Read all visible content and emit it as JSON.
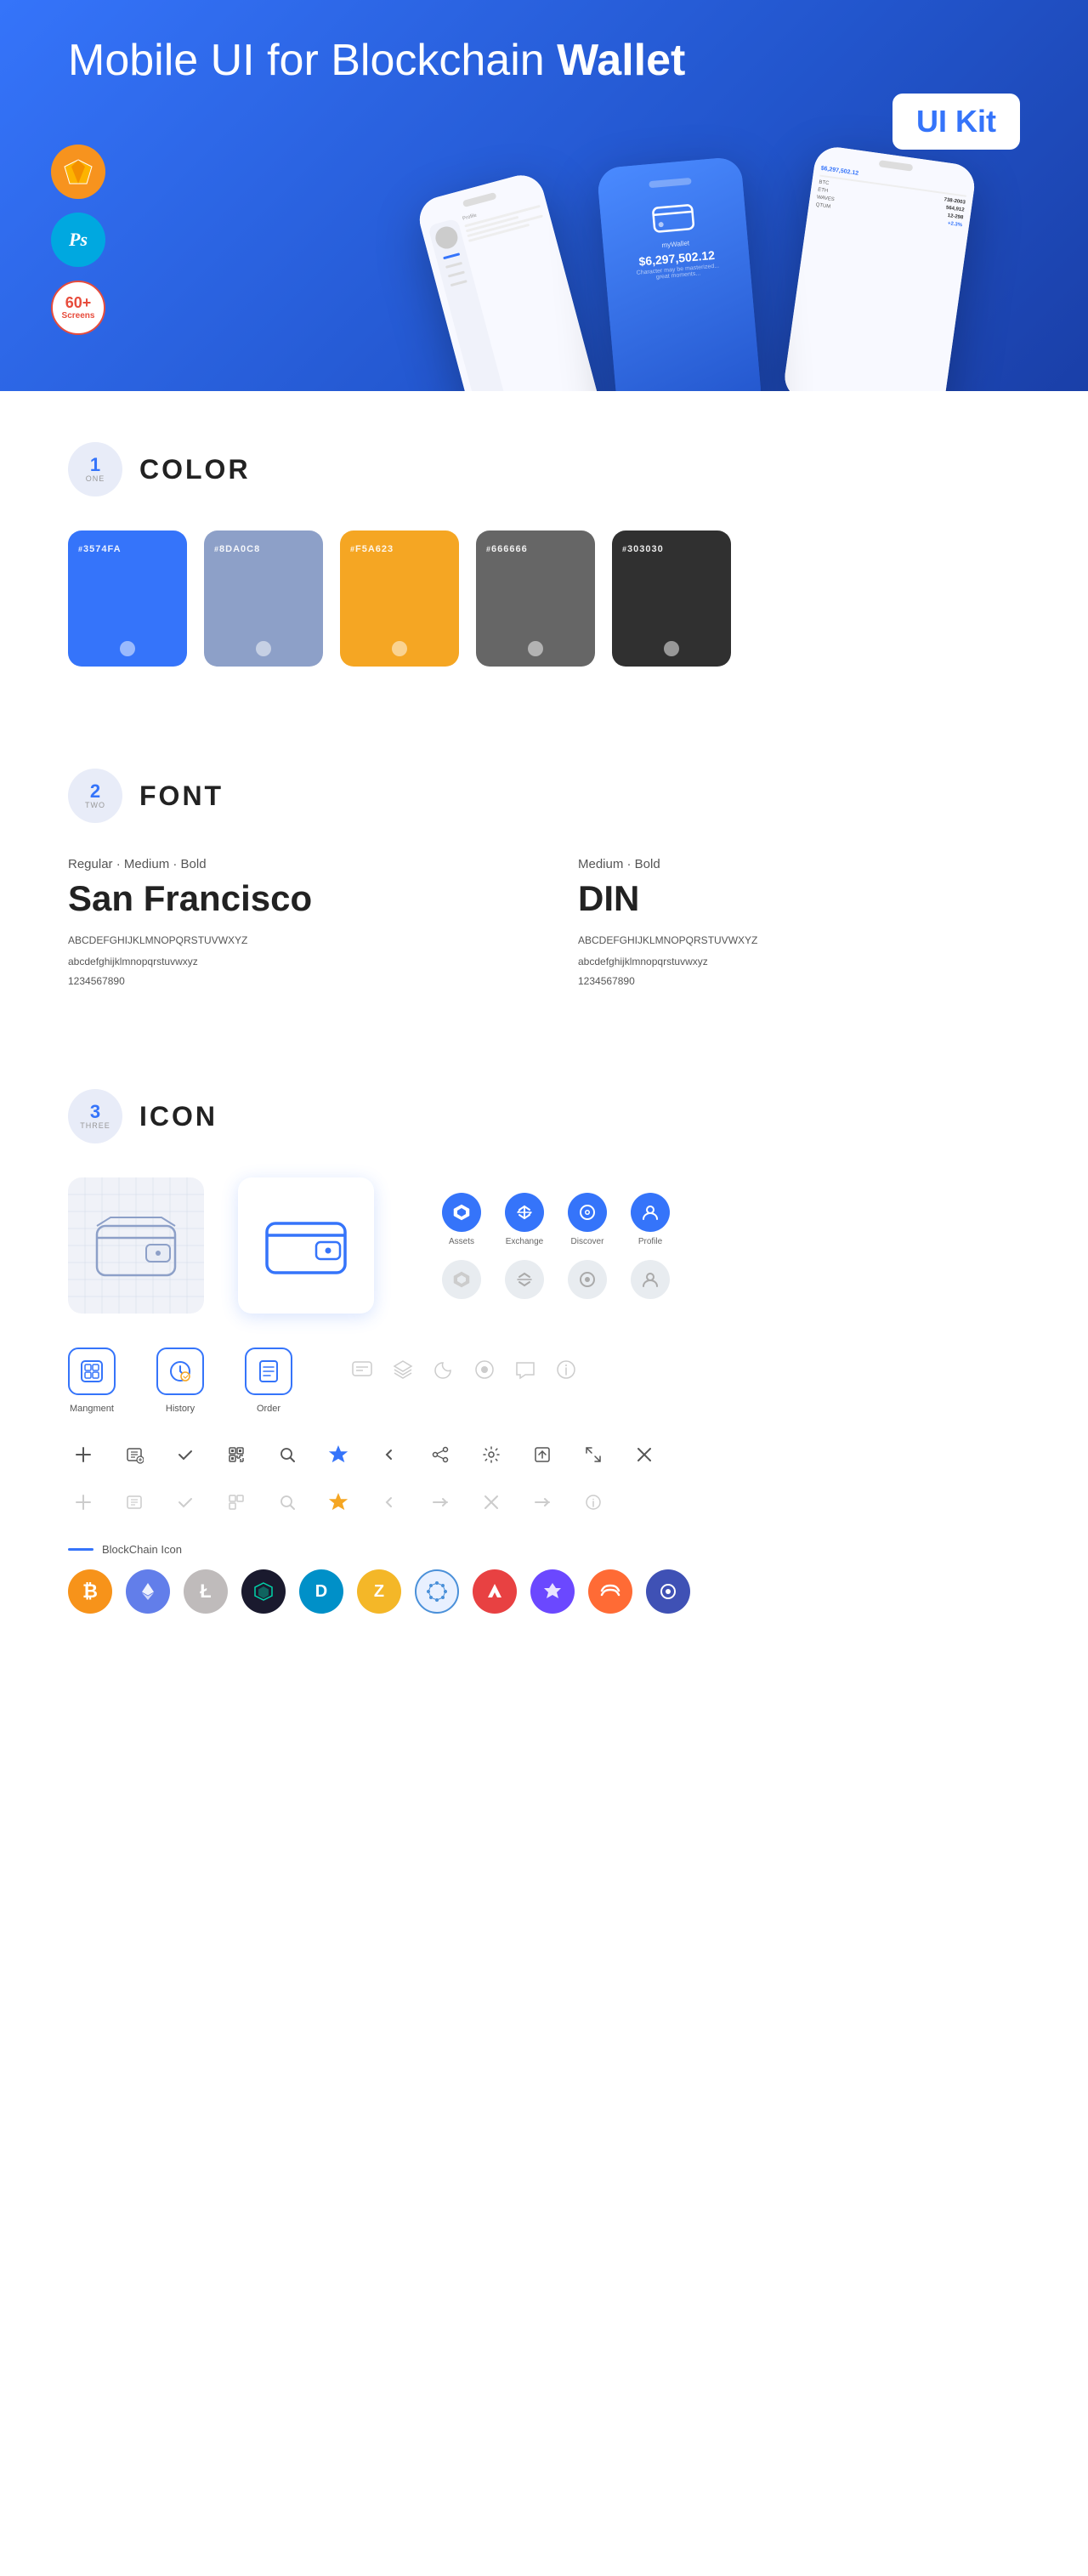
{
  "hero": {
    "title_normal": "Mobile UI for Blockchain ",
    "title_bold": "Wallet",
    "badge": "UI Kit",
    "badges": [
      {
        "label": "Sketch",
        "type": "sketch"
      },
      {
        "label": "Ps",
        "type": "ps"
      },
      {
        "label": "60+\nScreens",
        "type": "screens"
      }
    ]
  },
  "sections": {
    "color": {
      "number": "1",
      "word": "ONE",
      "title": "COLOR",
      "swatches": [
        {
          "hex": "3574FA",
          "bg": "#3574FA"
        },
        {
          "hex": "8DA0C8",
          "bg": "#8DA0C8"
        },
        {
          "hex": "F5A623",
          "bg": "#F5A623"
        },
        {
          "hex": "666666",
          "bg": "#666666"
        },
        {
          "hex": "303030",
          "bg": "#303030"
        }
      ]
    },
    "font": {
      "number": "2",
      "word": "TWO",
      "title": "FONT",
      "fonts": [
        {
          "style": "Regular · Medium · Bold",
          "name": "San Francisco",
          "uppercase": "ABCDEFGHIJKLMNOPQRSTUVWXYZ",
          "lowercase": "abcdefghijklmnopqrstuvwxyz",
          "numbers": "1234567890"
        },
        {
          "style": "Medium · Bold",
          "name": "DIN",
          "uppercase": "ABCDEFGHIJKLMNOPQRSTUVWXYZ",
          "lowercase": "abcdefghijklmnopqrstuvwxyz",
          "numbers": "1234567890"
        }
      ]
    },
    "icon": {
      "number": "3",
      "word": "THREE",
      "title": "ICON",
      "nav_icons": [
        {
          "label": "Assets",
          "type": "diamond-blue"
        },
        {
          "label": "Exchange",
          "type": "exchange-blue"
        },
        {
          "label": "Discover",
          "type": "discover-blue"
        },
        {
          "label": "Profile",
          "type": "profile-blue"
        }
      ],
      "nav_icons_gray": [
        {
          "label": "",
          "type": "diamond-gray"
        },
        {
          "label": "",
          "type": "exchange-gray"
        },
        {
          "label": "",
          "type": "discover-gray"
        },
        {
          "label": "",
          "type": "profile-gray"
        }
      ],
      "app_icons": [
        {
          "label": "Mangment",
          "type": "management"
        },
        {
          "label": "History",
          "type": "history"
        },
        {
          "label": "Order",
          "type": "order"
        }
      ],
      "misc_icons": [
        "chat",
        "layers",
        "moon",
        "circle",
        "message",
        "info"
      ],
      "tool_icons": [
        {
          "symbol": "+",
          "colored": false
        },
        {
          "symbol": "list",
          "colored": false
        },
        {
          "symbol": "✓",
          "colored": false
        },
        {
          "symbol": "qr",
          "colored": false
        },
        {
          "symbol": "search",
          "colored": false
        },
        {
          "symbol": "star",
          "colored": true
        },
        {
          "symbol": "<",
          "colored": false
        },
        {
          "symbol": "share",
          "colored": false
        },
        {
          "symbol": "gear",
          "colored": false
        },
        {
          "symbol": "box-upload",
          "colored": false
        },
        {
          "symbol": "resize",
          "colored": false
        },
        {
          "symbol": "×",
          "colored": false
        }
      ],
      "tool_icons_faded": [
        {
          "symbol": "+"
        },
        {
          "symbol": "list"
        },
        {
          "symbol": "✓"
        },
        {
          "symbol": "qr"
        },
        {
          "symbol": "search"
        },
        {
          "symbol": "star"
        },
        {
          "symbol": "<"
        },
        {
          "symbol": "→"
        },
        {
          "symbol": "×"
        },
        {
          "symbol": "→"
        },
        {
          "symbol": "info"
        }
      ],
      "blockchain_label": "BlockChain Icon",
      "crypto": [
        {
          "symbol": "₿",
          "bg": "#f7931a",
          "color": "#fff"
        },
        {
          "symbol": "⬡",
          "bg": "#627eea",
          "color": "#fff"
        },
        {
          "symbol": "Ł",
          "bg": "#bfbbbb",
          "color": "#fff"
        },
        {
          "symbol": "◆",
          "bg": "#1a1a2e",
          "color": "#00d4aa"
        },
        {
          "symbol": "D",
          "bg": "#0090c8",
          "color": "#fff"
        },
        {
          "symbol": "Z",
          "bg": "#f4b728",
          "color": "#fff"
        },
        {
          "symbol": "◈",
          "bg": "#4a90d9",
          "color": "#fff"
        },
        {
          "symbol": "▲",
          "bg": "#e84142",
          "color": "#fff"
        },
        {
          "symbol": "◇",
          "bg": "#6b48ff",
          "color": "#fff"
        },
        {
          "symbol": "⬡",
          "bg": "#ff6b35",
          "color": "#fff"
        },
        {
          "symbol": "◉",
          "bg": "#3f51b5",
          "color": "#fff"
        }
      ]
    }
  }
}
